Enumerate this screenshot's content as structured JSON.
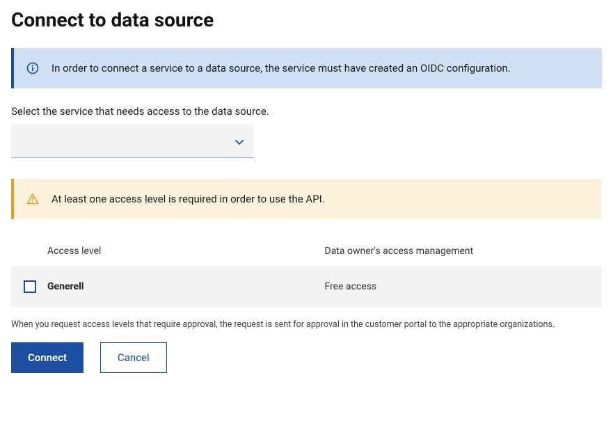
{
  "title": "Connect to data source",
  "info_alert": {
    "text": "In order to connect a service to a data source, the service must have created an OIDC configuration."
  },
  "service_select": {
    "label": "Select the service that needs access to the data source.",
    "value": ""
  },
  "warning_alert": {
    "text": "At least one access level is required in order to use the API."
  },
  "table": {
    "headers": {
      "access_level": "Access level",
      "management": "Data owner's access management"
    },
    "rows": [
      {
        "name": "Generell",
        "management": "Free access",
        "checked": false
      }
    ]
  },
  "helper_text": "When you request access levels that require approval, the request is sent for approval in the customer portal to the appropriate organizations.",
  "buttons": {
    "connect": "Connect",
    "cancel": "Cancel"
  },
  "colors": {
    "primary": "#1a4fa0",
    "info_bg": "#cfe0f5",
    "warning_bg": "#fdf3dc",
    "warning_accent": "#e4a11b"
  }
}
